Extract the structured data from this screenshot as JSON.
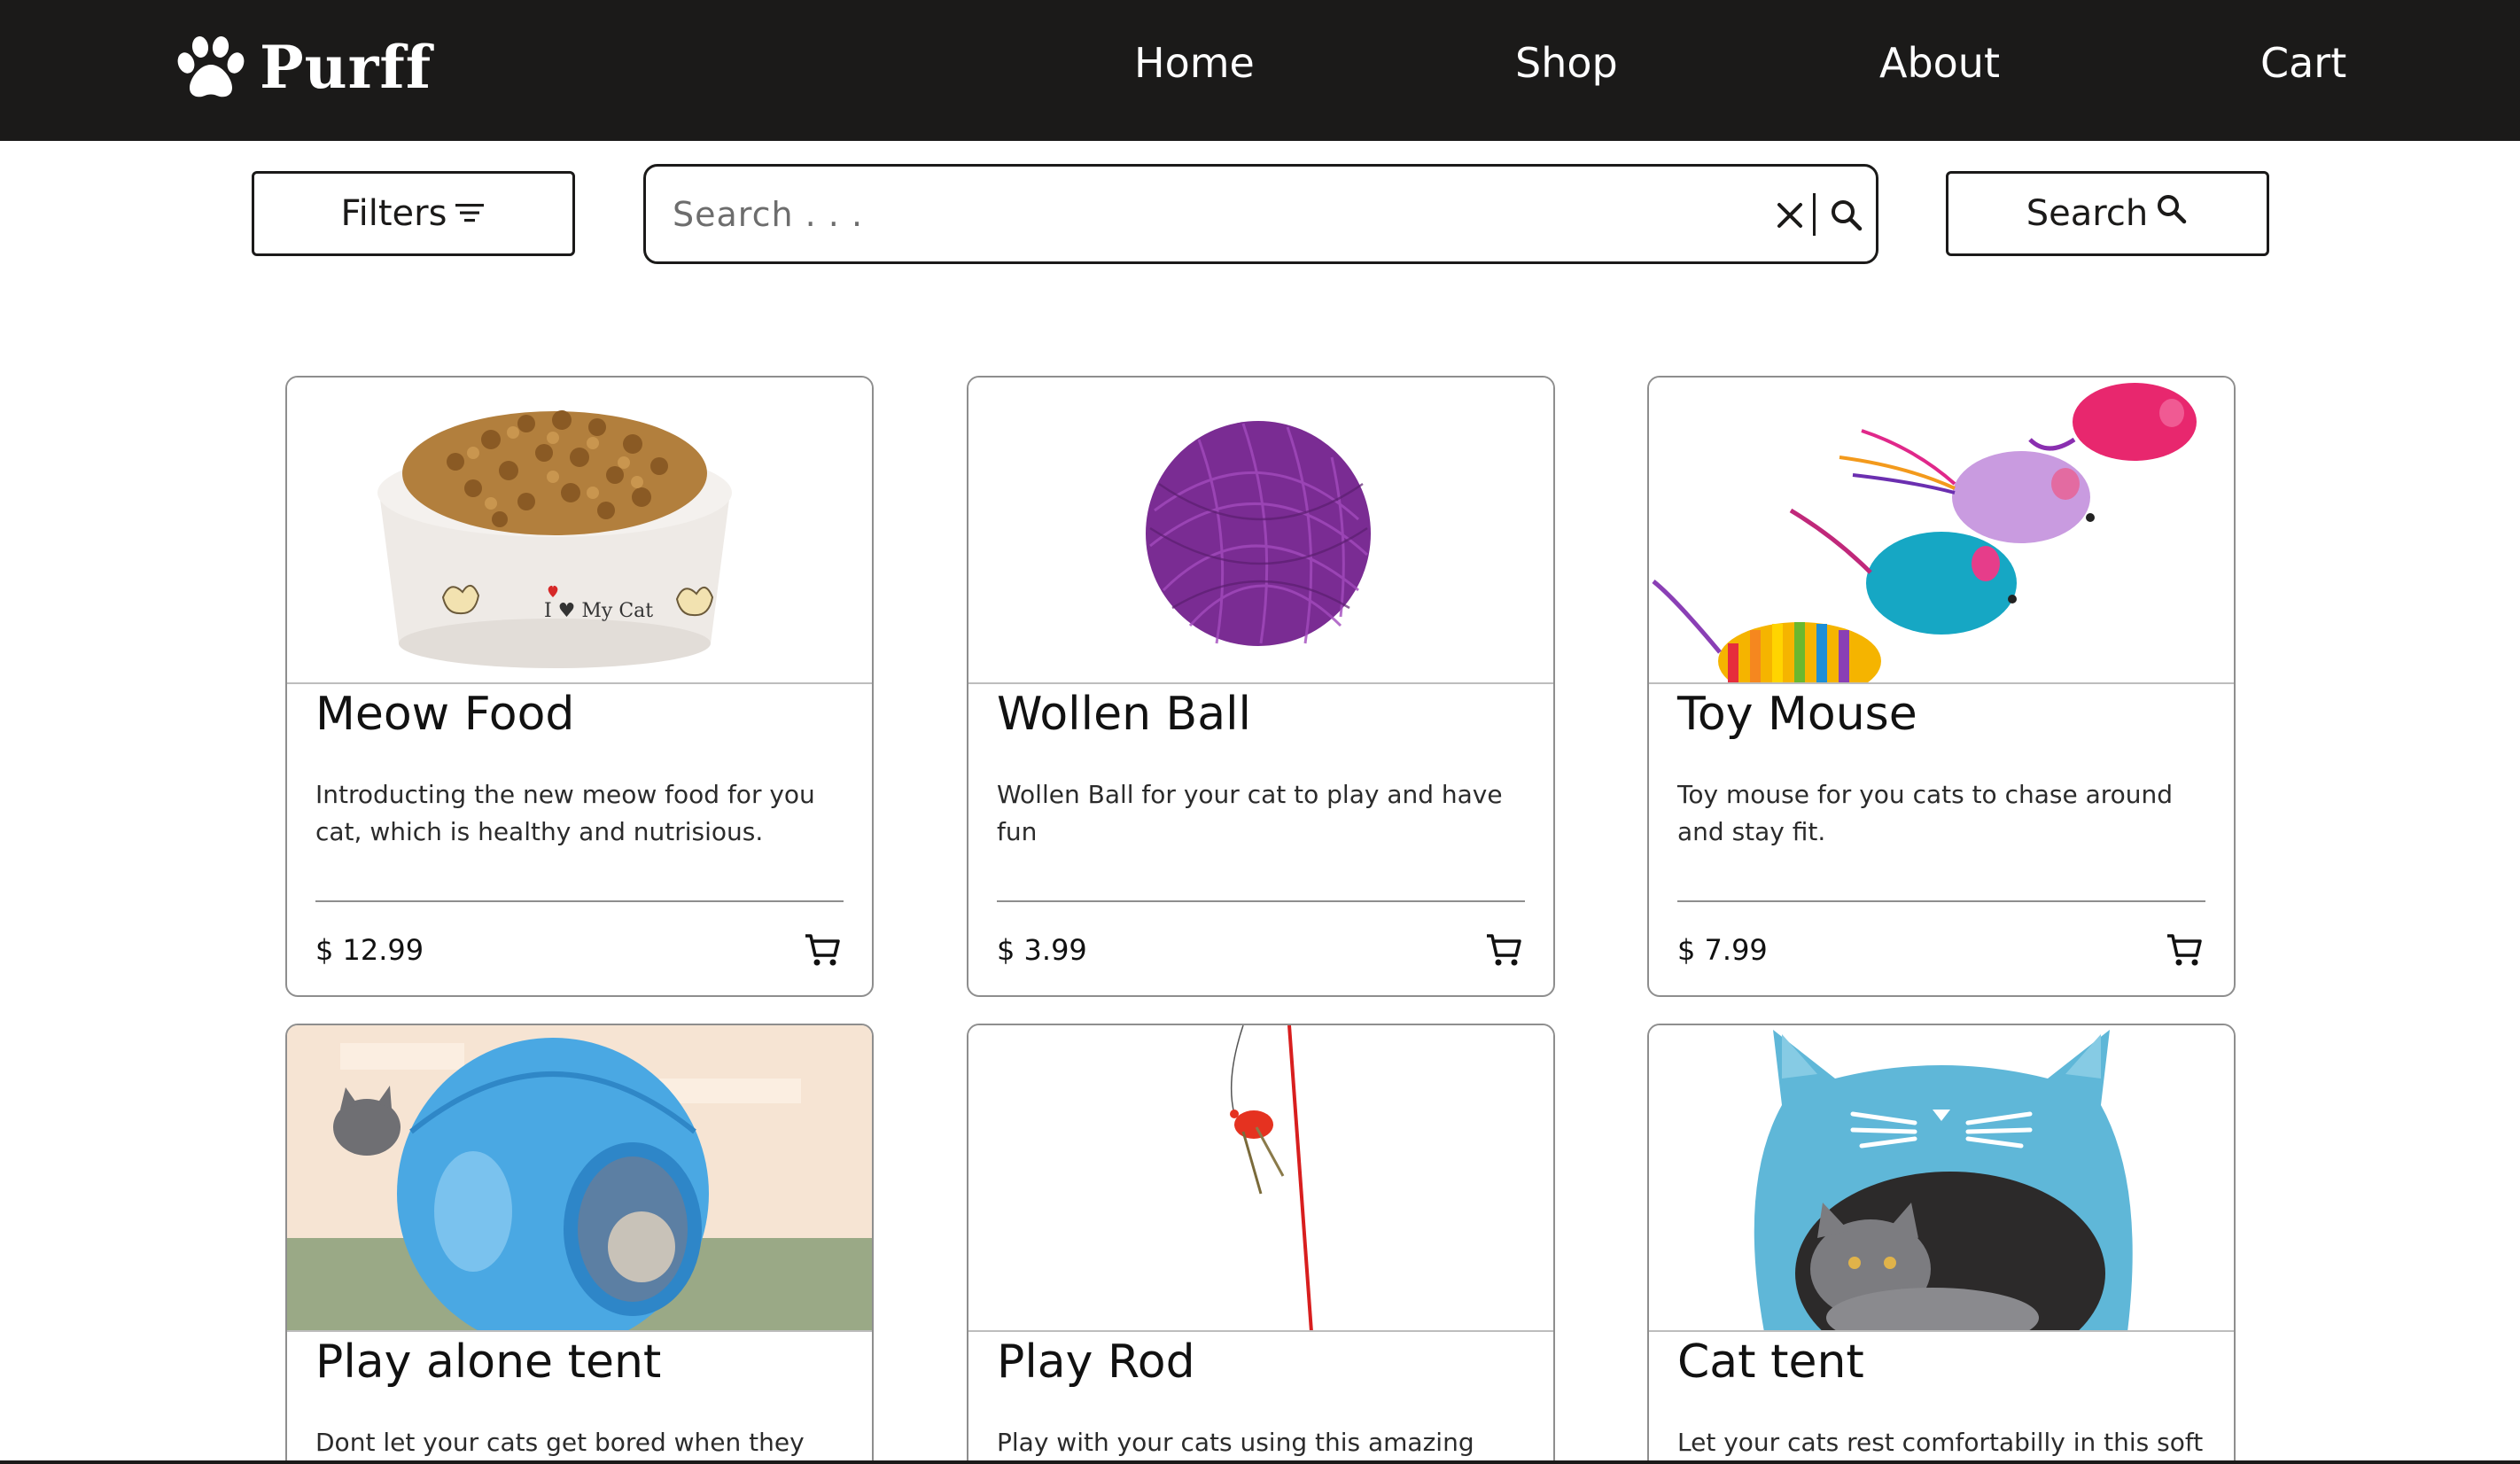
{
  "brand": {
    "name": "Purff",
    "icon": "paw-icon"
  },
  "nav": {
    "items": [
      {
        "label": "Home"
      },
      {
        "label": "Shop"
      },
      {
        "label": "About"
      },
      {
        "label": "Cart"
      }
    ]
  },
  "toolbar": {
    "filters_label": "Filters",
    "filters_icon": "filter-lines-icon",
    "search_placeholder": "Search . . .",
    "search_value": "",
    "search_button_label": "Search",
    "search_icon": "magnifier-icon",
    "clear_icon": "close-icon"
  },
  "products": [
    {
      "title": "Meow Food",
      "description": "Introducting the new meow food for you cat, which is healthy and nutrisious.",
      "price": "$ 12.99",
      "image": "food-bowl",
      "image_text": "I ♥ My Cat"
    },
    {
      "title": "Wollen Ball",
      "description": "Wollen Ball for your cat to play and have fun",
      "price": "$ 3.99",
      "image": "yarn-ball"
    },
    {
      "title": "Toy Mouse",
      "description": "Toy mouse for you cats to chase around and stay fit.",
      "price": "$ 7.99",
      "image": "toy-mice"
    },
    {
      "title": "Play alone tent",
      "description": "Dont let your cats get bored when they",
      "price": "",
      "image": "pop-up-tent"
    },
    {
      "title": "Play Rod",
      "description": "Play with your cats using this amazing",
      "price": "",
      "image": "feather-rod"
    },
    {
      "title": "Cat tent",
      "description": "Let your cats rest comfortabilly in this soft",
      "price": "",
      "image": "felt-cat-cave"
    }
  ],
  "colors": {
    "navbar_bg": "#1b1a19",
    "text_light": "#ffffff",
    "border": "#8e8e8e"
  }
}
